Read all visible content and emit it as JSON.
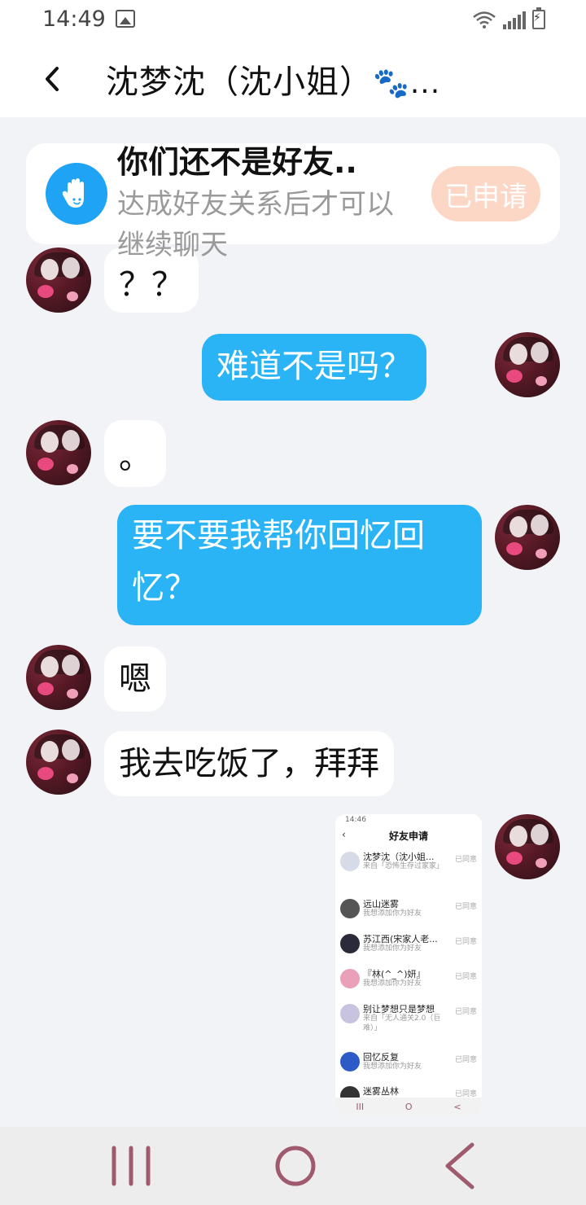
{
  "status_bar": {
    "time": "14:49"
  },
  "header": {
    "title": "沈梦沈（沈小姐）",
    "title_suffix": "🐾..."
  },
  "friend_banner": {
    "title": "你们还不是好友..",
    "description": "达成好友关系后才可以继续聊天",
    "button_label": "已申请",
    "icon": "hand-wave-icon"
  },
  "messages": [
    {
      "side": "in",
      "text": "？？"
    },
    {
      "side": "out",
      "text": "难道不是吗？"
    },
    {
      "side": "in",
      "text": "。"
    },
    {
      "side": "out",
      "text": "要不要我帮你回忆回忆？"
    },
    {
      "side": "in",
      "text": "嗯"
    },
    {
      "side": "in",
      "text": "我去吃饭了，拜拜"
    }
  ],
  "screenshot_message": {
    "time": "14:46",
    "title": "好友申请",
    "items": [
      {
        "name": "沈梦沈（沈小姐...",
        "sub": "来自「恐怖生存过家家」",
        "status": "已同意"
      },
      {
        "name": "远山迷雾",
        "sub": "我想添加你为好友",
        "status": "已同意"
      },
      {
        "name": "苏江西(宋家人老...",
        "sub": "我想添加你为好友",
        "status": "已同意"
      },
      {
        "name": "『林(^_^)妍』",
        "sub": "我想添加你为好友",
        "status": "已同意"
      },
      {
        "name": "别让梦想只是梦想",
        "sub": "来自「无人通关2.0（巨难）」",
        "status": "已同意"
      },
      {
        "name": "回忆反复",
        "sub": "我想添加你为好友",
        "status": "已同意"
      },
      {
        "name": "迷雾丛林",
        "sub": "",
        "status": "已同意"
      }
    ]
  },
  "colors": {
    "outgoing_bubble": "#2ab4f5",
    "incoming_bubble": "#ffffff",
    "apply_button": "#fcd7c6",
    "nav_icon": "#a05a6e"
  }
}
